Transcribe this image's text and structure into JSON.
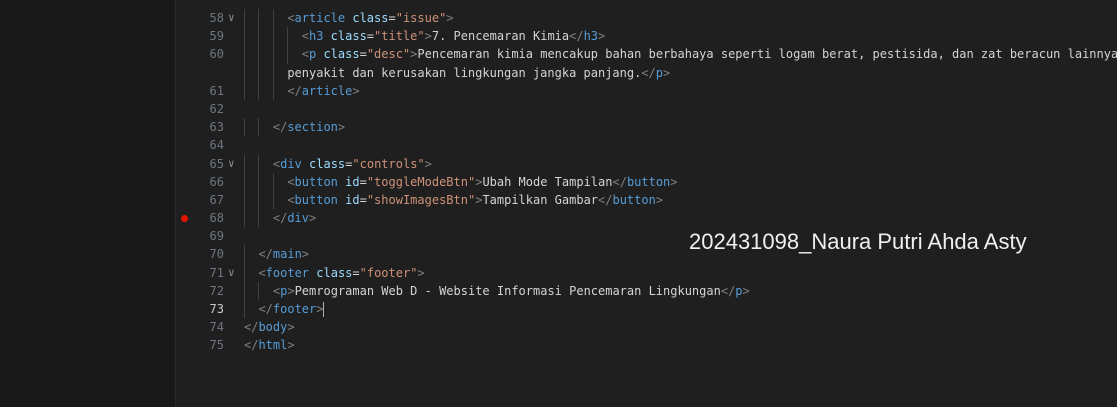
{
  "editor": {
    "lines": [
      {
        "num": "58",
        "fold": true,
        "indent": 3,
        "parts": [
          [
            "br",
            "<"
          ],
          [
            "tag",
            "article"
          ],
          [
            "txt",
            " "
          ],
          [
            "attr",
            "class"
          ],
          [
            "txt",
            "="
          ],
          [
            "val",
            "\"issue\""
          ],
          [
            "br",
            ">"
          ]
        ]
      },
      {
        "num": "59",
        "indent": 4,
        "parts": [
          [
            "br",
            "<"
          ],
          [
            "tag",
            "h3"
          ],
          [
            "txt",
            " "
          ],
          [
            "attr",
            "class"
          ],
          [
            "txt",
            "="
          ],
          [
            "val",
            "\"title\""
          ],
          [
            "br",
            ">"
          ],
          [
            "txt",
            "7. Pencemaran Kimia"
          ],
          [
            "br",
            "</"
          ],
          [
            "tag",
            "h3"
          ],
          [
            "br",
            ">"
          ]
        ]
      },
      {
        "num": "60",
        "indent": 4,
        "parts": [
          [
            "br",
            "<"
          ],
          [
            "tag",
            "p"
          ],
          [
            "txt",
            " "
          ],
          [
            "attr",
            "class"
          ],
          [
            "txt",
            "="
          ],
          [
            "val",
            "\"desc\""
          ],
          [
            "br",
            ">"
          ],
          [
            "txt",
            "Pencemaran kimia mencakup bahan berbahaya seperti logam berat, pestisida, dan zat beracun lainnya"
          ]
        ]
      },
      {
        "num": "",
        "indent": 3,
        "parts": [
          [
            "txt",
            "penyakit dan kerusakan lingkungan jangka panjang."
          ],
          [
            "br",
            "</"
          ],
          [
            "tag",
            "p"
          ],
          [
            "br",
            ">"
          ]
        ]
      },
      {
        "num": "61",
        "indent": 3,
        "parts": [
          [
            "br",
            "</"
          ],
          [
            "tag",
            "article"
          ],
          [
            "br",
            ">"
          ]
        ]
      },
      {
        "num": "62",
        "indent": 0,
        "parts": []
      },
      {
        "num": "63",
        "indent": 2,
        "parts": [
          [
            "br",
            "</"
          ],
          [
            "tag",
            "section"
          ],
          [
            "br",
            ">"
          ]
        ]
      },
      {
        "num": "64",
        "indent": 0,
        "parts": []
      },
      {
        "num": "65",
        "fold": true,
        "indent": 2,
        "parts": [
          [
            "br",
            "<"
          ],
          [
            "tag",
            "div"
          ],
          [
            "txt",
            " "
          ],
          [
            "attr",
            "class"
          ],
          [
            "txt",
            "="
          ],
          [
            "val",
            "\"controls\""
          ],
          [
            "br",
            ">"
          ]
        ]
      },
      {
        "num": "66",
        "indent": 3,
        "parts": [
          [
            "br",
            "<"
          ],
          [
            "tag",
            "button"
          ],
          [
            "txt",
            " "
          ],
          [
            "attr",
            "id"
          ],
          [
            "txt",
            "="
          ],
          [
            "val",
            "\"toggleModeBtn\""
          ],
          [
            "br",
            ">"
          ],
          [
            "txt",
            "Ubah Mode Tampilan"
          ],
          [
            "br",
            "</"
          ],
          [
            "tag",
            "button"
          ],
          [
            "br",
            ">"
          ]
        ]
      },
      {
        "num": "67",
        "indent": 3,
        "parts": [
          [
            "br",
            "<"
          ],
          [
            "tag",
            "button"
          ],
          [
            "txt",
            " "
          ],
          [
            "attr",
            "id"
          ],
          [
            "txt",
            "="
          ],
          [
            "val",
            "\"showImagesBtn\""
          ],
          [
            "br",
            ">"
          ],
          [
            "txt",
            "Tampilkan Gambar"
          ],
          [
            "br",
            "</"
          ],
          [
            "tag",
            "button"
          ],
          [
            "br",
            ">"
          ]
        ]
      },
      {
        "num": "68",
        "breakpoint": true,
        "indent": 2,
        "parts": [
          [
            "br",
            "</"
          ],
          [
            "tag",
            "div"
          ],
          [
            "br",
            ">"
          ]
        ]
      },
      {
        "num": "69",
        "indent": 0,
        "parts": []
      },
      {
        "num": "70",
        "indent": 1,
        "parts": [
          [
            "br",
            "</"
          ],
          [
            "tag",
            "main"
          ],
          [
            "br",
            ">"
          ]
        ]
      },
      {
        "num": "71",
        "fold": true,
        "indent": 1,
        "parts": [
          [
            "br",
            "<"
          ],
          [
            "tag",
            "footer"
          ],
          [
            "txt",
            " "
          ],
          [
            "attr",
            "class"
          ],
          [
            "txt",
            "="
          ],
          [
            "val",
            "\"footer\""
          ],
          [
            "br",
            ">"
          ]
        ]
      },
      {
        "num": "72",
        "indent": 2,
        "parts": [
          [
            "br",
            "<"
          ],
          [
            "tag",
            "p"
          ],
          [
            "br",
            ">"
          ],
          [
            "txt",
            "Pemrograman Web D - Website Informasi Pencemaran Lingkungan"
          ],
          [
            "br",
            "</"
          ],
          [
            "tag",
            "p"
          ],
          [
            "br",
            ">"
          ]
        ]
      },
      {
        "num": "73",
        "current": true,
        "cursor": true,
        "indent": 1,
        "parts": [
          [
            "br",
            "</"
          ],
          [
            "tag",
            "footer"
          ],
          [
            "br",
            ">"
          ]
        ]
      },
      {
        "num": "74",
        "indent": 0,
        "parts": [
          [
            "br",
            "</"
          ],
          [
            "tag",
            "body"
          ],
          [
            "br",
            ">"
          ]
        ]
      },
      {
        "num": "75",
        "indent": 0,
        "parts": [
          [
            "br",
            "</"
          ],
          [
            "tag",
            "html"
          ],
          [
            "br",
            ">"
          ]
        ]
      }
    ]
  },
  "watermark": "202431098_Naura Putri Ahda Asty",
  "icons": {
    "fold": "chevron-down-icon",
    "breakpoint": "breakpoint-dot-icon"
  },
  "colors": {
    "background": "#1f1f1f",
    "tag": "#569cd6",
    "attribute": "#9cdcfe",
    "string": "#ce9178",
    "bracket": "#808080",
    "text": "#d4d4d4",
    "breakpoint": "#e51400"
  }
}
